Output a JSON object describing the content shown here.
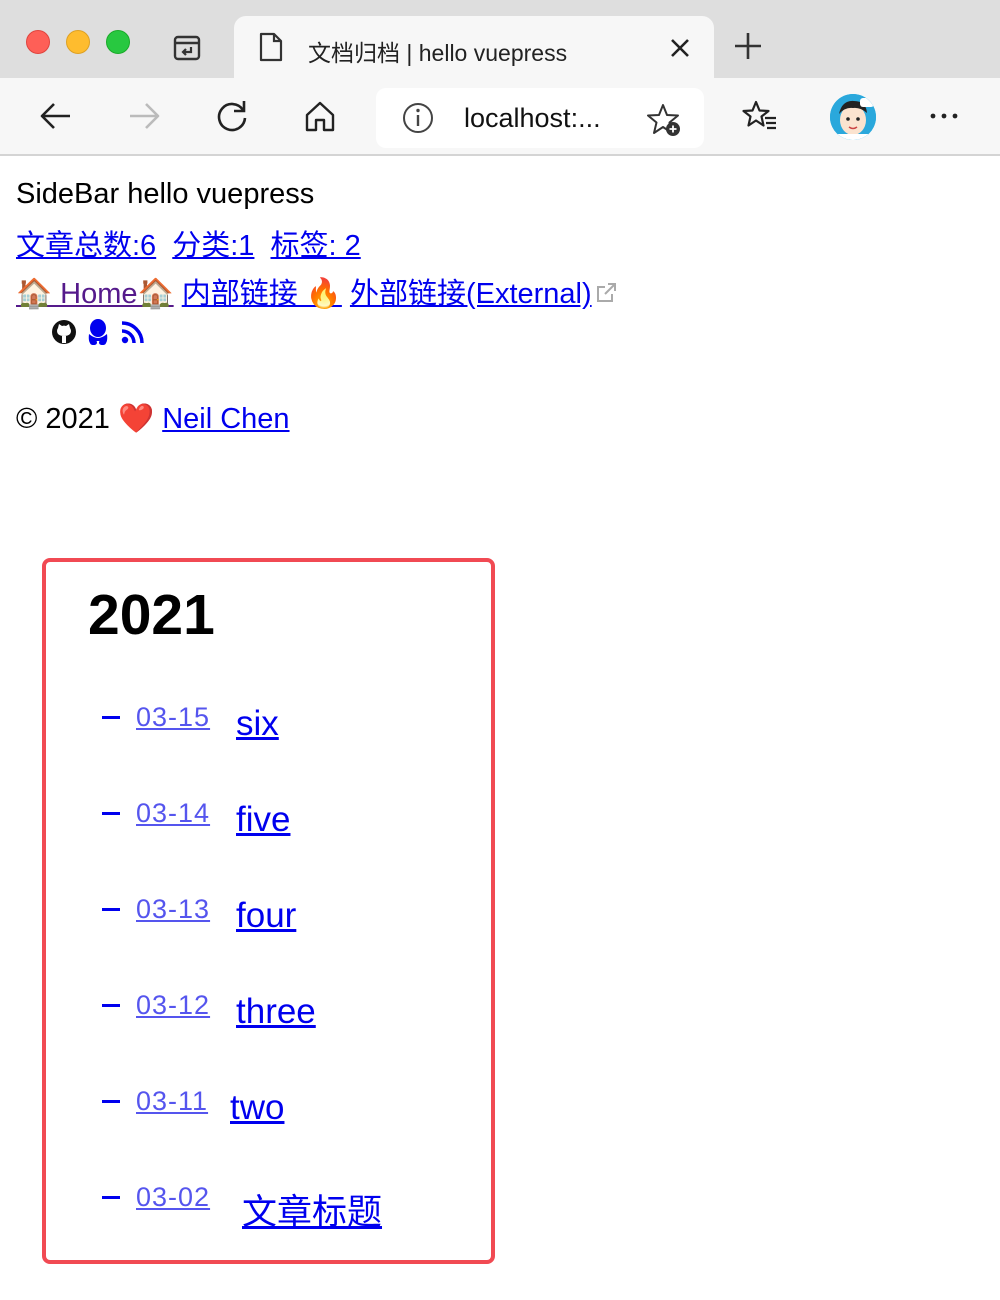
{
  "browser": {
    "tab": {
      "title": "文档归档 | hello vuepress"
    },
    "address": {
      "url": "localhost:..."
    }
  },
  "header": {
    "site_title": "SideBar hello vuepress",
    "stats": [
      {
        "label": "文章总数:6"
      },
      {
        "label": "分类:1"
      },
      {
        "label": "标签: 2"
      }
    ]
  },
  "nav": {
    "home": "🏠 Home🏠",
    "internal": "内部链接 🔥",
    "external": "外部链接(External)"
  },
  "social": [
    "github-icon",
    "qq-icon",
    "rss-icon"
  ],
  "footer": {
    "copyright": "© 2021",
    "heart": "❤️",
    "author": "Neil Chen"
  },
  "archive": {
    "year": "2021",
    "posts": [
      {
        "date": "03-15",
        "title": "six"
      },
      {
        "date": "03-14",
        "title": "five"
      },
      {
        "date": "03-13",
        "title": "four"
      },
      {
        "date": "03-12",
        "title": "three"
      },
      {
        "date": "03-11",
        "title": "two"
      },
      {
        "date": "03-02",
        "title": "文章标题"
      }
    ]
  },
  "colors": {
    "link": "#0000ee",
    "visited": "#551a8b",
    "archive_border": "#f14a53"
  }
}
